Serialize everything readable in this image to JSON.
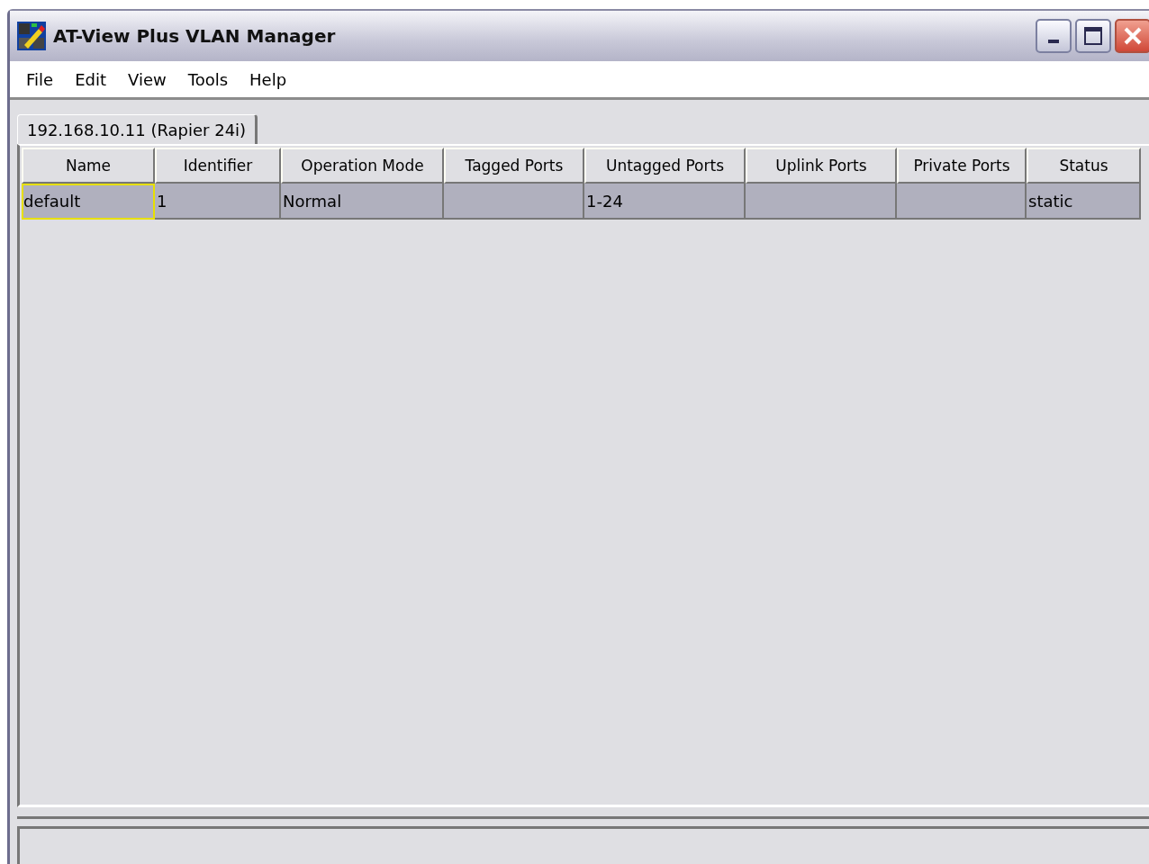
{
  "window": {
    "title": "AT-View Plus VLAN Manager"
  },
  "menu": [
    "File",
    "Edit",
    "View",
    "Tools",
    "Help"
  ],
  "tabs": [
    {
      "label": "192.168.10.11 (Rapier 24i)",
      "selected": true
    }
  ],
  "table": {
    "columns": [
      "Name",
      "Identifier",
      "Operation Mode",
      "Tagged Ports",
      "Untagged Ports",
      "Uplink Ports",
      "Private Ports",
      "Status"
    ],
    "rows": [
      {
        "selected": true,
        "cells": [
          {
            "text": "default",
            "focused": true
          },
          {
            "text": "1",
            "focused": false
          },
          {
            "text": "Normal",
            "focused": false
          },
          {
            "text": "",
            "focused": false
          },
          {
            "text": "1-24",
            "focused": false
          },
          {
            "text": "",
            "focused": false
          },
          {
            "text": "",
            "focused": false
          },
          {
            "text": "static",
            "focused": false
          }
        ]
      }
    ]
  }
}
